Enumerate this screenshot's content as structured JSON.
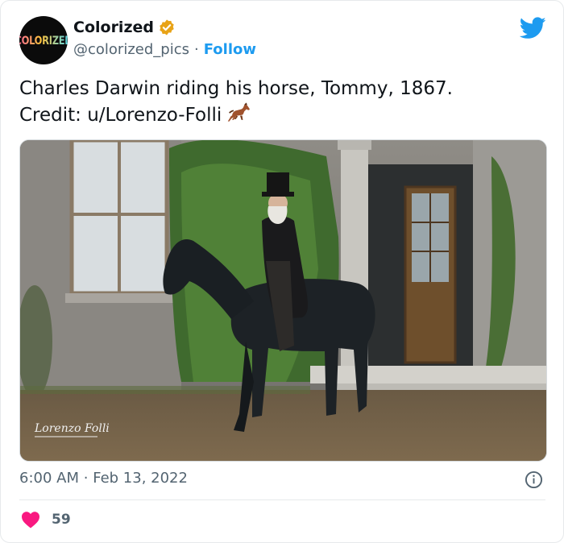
{
  "header": {
    "avatar_text": "COLORIZED",
    "display_name": "Colorized",
    "handle": "@colorized_pics",
    "separator": "·",
    "follow_label": "Follow",
    "verified_icon": "verified-badge-gold",
    "platform_icon": "twitter-bird-icon"
  },
  "tweet": {
    "line1": "Charles Darwin riding his horse, Tommy, 1867.",
    "line2": "Credit: u/Lorenzo-Folli",
    "emoji": "horse-emoji",
    "photo": {
      "watermark": "Lorenzo Folli"
    }
  },
  "meta": {
    "time": "6:00 AM",
    "separator": "·",
    "date": "Feb 13, 2022"
  },
  "engagement": {
    "likes": "59"
  },
  "colors": {
    "accent": "#1d9bf0",
    "verified": "#e8a317",
    "heart": "#f91880",
    "secondary_text": "#536471"
  }
}
